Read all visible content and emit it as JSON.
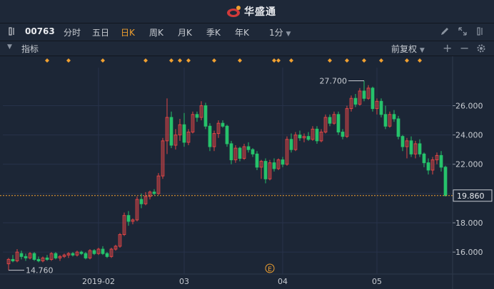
{
  "app": {
    "brand": "华盛通"
  },
  "toolbar": {
    "stock_code": "00763",
    "periods": [
      "分时",
      "五日",
      "日K",
      "周K",
      "月K",
      "季K",
      "年K"
    ],
    "active_period": "日K",
    "interval_label": "1分"
  },
  "indicator_bar": {
    "label": "指标",
    "adjust_label": "前复权"
  },
  "colors": {
    "up": "#e04545",
    "down": "#26c26b",
    "accent": "#f0a030",
    "background": "#1c2636",
    "marker": "#f0a030"
  },
  "icons": {
    "left": "panel-toggle-icon",
    "edit": "pencil-icon",
    "expand": "expand-icon",
    "layout": "split-icon",
    "add": "plus-icon",
    "remove": "minus-icon",
    "settings": "gear-icon"
  },
  "chart_data": {
    "type": "candlestick",
    "ylim": [
      14.5,
      28.6
    ],
    "y_ticks": [
      "16.000",
      "18.000",
      "20.000",
      "22.000",
      "24.000",
      "26.000"
    ],
    "x_ticks": [
      {
        "label": "2019-02",
        "index": 21
      },
      {
        "label": "03",
        "index": 41
      },
      {
        "label": "04",
        "index": 64
      },
      {
        "label": "05",
        "index": 86
      }
    ],
    "current_price": "19.860",
    "max_label": "27.700",
    "min_label": "14.760",
    "event_label": "E",
    "event_index": 61,
    "marker_indices": [
      9,
      14,
      22,
      32,
      38,
      40,
      42,
      48,
      54,
      62,
      63,
      66,
      75,
      79,
      83,
      87,
      93,
      96
    ],
    "candles": [
      [
        15.2,
        15.6,
        14.76,
        15.5
      ],
      [
        15.5,
        15.8,
        15.3,
        15.4
      ],
      [
        15.4,
        16.2,
        15.3,
        16.0
      ],
      [
        15.9,
        16.1,
        15.5,
        15.7
      ],
      [
        15.7,
        15.9,
        15.4,
        15.6
      ],
      [
        15.6,
        16.0,
        15.5,
        15.9
      ],
      [
        15.9,
        16.0,
        15.4,
        15.5
      ],
      [
        15.5,
        15.7,
        15.3,
        15.4
      ],
      [
        15.4,
        15.7,
        15.3,
        15.6
      ],
      [
        15.6,
        15.8,
        15.4,
        15.5
      ],
      [
        15.5,
        16.0,
        15.4,
        15.9
      ],
      [
        15.9,
        16.0,
        15.5,
        15.6
      ],
      [
        15.6,
        15.8,
        15.4,
        15.7
      ],
      [
        15.7,
        15.9,
        15.6,
        15.8
      ],
      [
        15.8,
        16.0,
        15.6,
        15.9
      ],
      [
        15.9,
        16.0,
        15.7,
        15.8
      ],
      [
        15.8,
        16.1,
        15.7,
        16.0
      ],
      [
        16.0,
        16.1,
        15.8,
        15.9
      ],
      [
        15.9,
        16.0,
        15.5,
        15.6
      ],
      [
        15.6,
        16.2,
        15.5,
        16.1
      ],
      [
        16.1,
        16.2,
        15.8,
        15.9
      ],
      [
        15.9,
        16.3,
        15.8,
        16.2
      ],
      [
        16.2,
        16.4,
        15.8,
        15.9
      ],
      [
        15.9,
        16.0,
        15.6,
        15.7
      ],
      [
        15.7,
        16.3,
        15.6,
        16.2
      ],
      [
        16.2,
        16.5,
        16.1,
        16.4
      ],
      [
        16.4,
        17.3,
        16.3,
        17.2
      ],
      [
        17.2,
        18.7,
        17.1,
        18.5
      ],
      [
        18.5,
        18.8,
        17.8,
        18.1
      ],
      [
        18.1,
        18.3,
        17.9,
        18.2
      ],
      [
        18.2,
        19.8,
        18.1,
        19.6
      ],
      [
        19.6,
        20.0,
        19.0,
        19.3
      ],
      [
        19.3,
        20.1,
        19.2,
        19.8
      ],
      [
        19.8,
        20.2,
        19.6,
        20.1
      ],
      [
        20.1,
        20.3,
        19.9,
        20.0
      ],
      [
        20.0,
        21.4,
        19.9,
        21.2
      ],
      [
        21.2,
        23.8,
        21.0,
        23.6
      ],
      [
        23.6,
        26.5,
        22.7,
        25.2
      ],
      [
        25.2,
        25.6,
        23.1,
        23.3
      ],
      [
        23.3,
        24.4,
        23.0,
        24.0
      ],
      [
        24.0,
        25.1,
        23.6,
        24.7
      ],
      [
        24.7,
        25.5,
        23.2,
        23.5
      ],
      [
        23.5,
        24.4,
        23.3,
        24.2
      ],
      [
        24.2,
        25.6,
        24.1,
        25.4
      ],
      [
        25.4,
        25.6,
        24.9,
        25.2
      ],
      [
        25.2,
        26.3,
        25.0,
        26.0
      ],
      [
        26.0,
        26.2,
        24.4,
        24.6
      ],
      [
        24.6,
        24.8,
        22.9,
        23.2
      ],
      [
        23.2,
        24.3,
        22.9,
        24.1
      ],
      [
        24.1,
        25.0,
        23.8,
        24.8
      ],
      [
        24.8,
        25.0,
        24.5,
        24.6
      ],
      [
        24.6,
        24.7,
        23.2,
        23.4
      ],
      [
        23.4,
        23.6,
        22.0,
        22.3
      ],
      [
        22.3,
        23.3,
        22.1,
        23.1
      ],
      [
        23.1,
        23.2,
        22.2,
        22.4
      ],
      [
        22.4,
        23.4,
        22.3,
        23.2
      ],
      [
        23.2,
        23.5,
        22.8,
        23.0
      ],
      [
        23.0,
        23.1,
        22.5,
        22.7
      ],
      [
        22.7,
        22.9,
        21.6,
        21.8
      ],
      [
        21.8,
        22.3,
        21.0,
        22.2
      ],
      [
        22.2,
        22.4,
        20.7,
        21.0
      ],
      [
        21.0,
        22.3,
        20.9,
        22.1
      ],
      [
        22.1,
        22.4,
        21.5,
        21.7
      ],
      [
        21.7,
        22.4,
        21.6,
        22.3
      ],
      [
        22.3,
        22.5,
        21.8,
        22.0
      ],
      [
        22.0,
        23.9,
        21.9,
        23.7
      ],
      [
        23.7,
        24.1,
        22.8,
        23.0
      ],
      [
        23.0,
        24.2,
        22.9,
        24.0
      ],
      [
        24.0,
        24.3,
        23.6,
        23.8
      ],
      [
        23.8,
        24.1,
        23.5,
        23.9
      ],
      [
        23.9,
        24.2,
        23.6,
        23.7
      ],
      [
        23.7,
        24.6,
        23.6,
        24.4
      ],
      [
        24.4,
        24.6,
        23.4,
        23.6
      ],
      [
        23.6,
        24.4,
        23.5,
        24.2
      ],
      [
        24.2,
        25.4,
        24.1,
        25.2
      ],
      [
        25.2,
        25.4,
        24.6,
        24.8
      ],
      [
        24.8,
        25.6,
        24.7,
        25.4
      ],
      [
        25.4,
        25.6,
        24.0,
        24.2
      ],
      [
        24.2,
        24.4,
        23.7,
        23.9
      ],
      [
        23.9,
        26.0,
        23.8,
        25.8
      ],
      [
        25.8,
        26.7,
        25.6,
        26.5
      ],
      [
        26.5,
        26.8,
        25.9,
        26.1
      ],
      [
        26.1,
        27.2,
        26.0,
        27.0
      ],
      [
        27.0,
        27.7,
        26.3,
        26.5
      ],
      [
        26.5,
        27.4,
        26.4,
        27.2
      ],
      [
        27.2,
        27.3,
        25.6,
        25.8
      ],
      [
        25.8,
        26.5,
        25.4,
        26.3
      ],
      [
        26.3,
        26.5,
        25.2,
        25.4
      ],
      [
        25.4,
        26.0,
        24.4,
        24.6
      ],
      [
        24.6,
        25.6,
        24.5,
        25.4
      ],
      [
        25.4,
        25.7,
        24.9,
        25.1
      ],
      [
        25.1,
        25.3,
        23.7,
        23.9
      ],
      [
        23.9,
        24.0,
        22.9,
        23.2
      ],
      [
        23.2,
        23.8,
        22.4,
        23.6
      ],
      [
        23.6,
        23.9,
        22.5,
        22.7
      ],
      [
        22.7,
        23.6,
        22.4,
        23.4
      ],
      [
        23.4,
        23.7,
        22.5,
        22.7
      ],
      [
        22.7,
        22.8,
        21.8,
        22.1
      ],
      [
        22.1,
        22.4,
        21.3,
        21.6
      ],
      [
        21.6,
        22.5,
        21.3,
        22.3
      ],
      [
        22.3,
        22.8,
        22.0,
        22.6
      ],
      [
        22.6,
        22.9,
        21.5,
        21.8
      ],
      [
        21.8,
        21.9,
        19.8,
        19.86
      ]
    ]
  }
}
